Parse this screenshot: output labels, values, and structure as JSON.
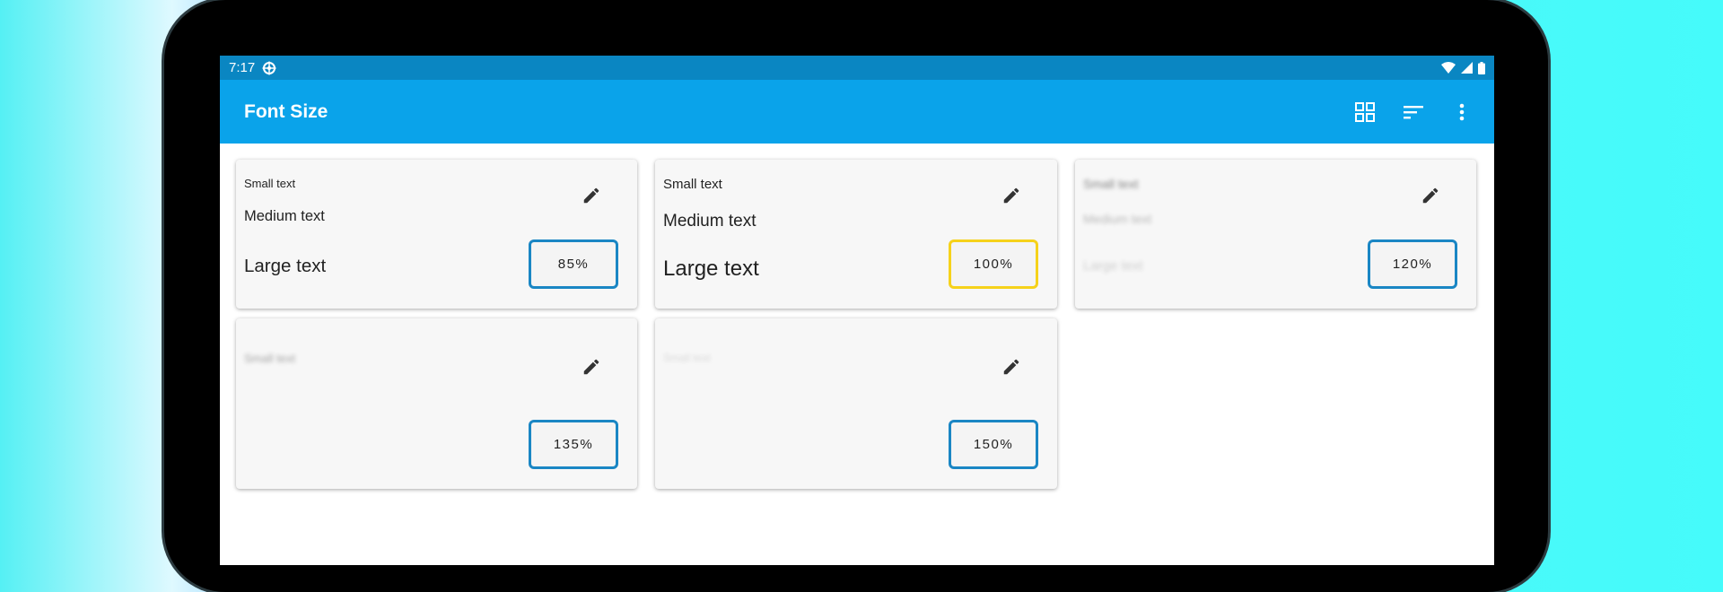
{
  "status_bar": {
    "time": "7:17"
  },
  "app_bar": {
    "title": "Font Size"
  },
  "colors": {
    "primary": "#0aa3ea",
    "status_bar": "#0a86c2",
    "selected_border": "#f6d21b",
    "option_border": "#1a86c4"
  },
  "icons": {
    "grid": "grid-view-icon",
    "sort": "sort-icon",
    "more": "more-vert-icon",
    "edit": "pencil-icon"
  },
  "options": [
    {
      "small": "Small text",
      "medium": "Medium text",
      "large": "Large text",
      "percent": "85%"
    },
    {
      "small": "Small text",
      "medium": "Medium text",
      "large": "Large text",
      "percent": "100%",
      "selected": true
    },
    {
      "small": "Small text",
      "medium": "Medium text",
      "large": "Large text",
      "percent": "120%"
    },
    {
      "small": "Small text",
      "percent": "135%"
    },
    {
      "small": "Small text",
      "percent": "150%"
    }
  ]
}
